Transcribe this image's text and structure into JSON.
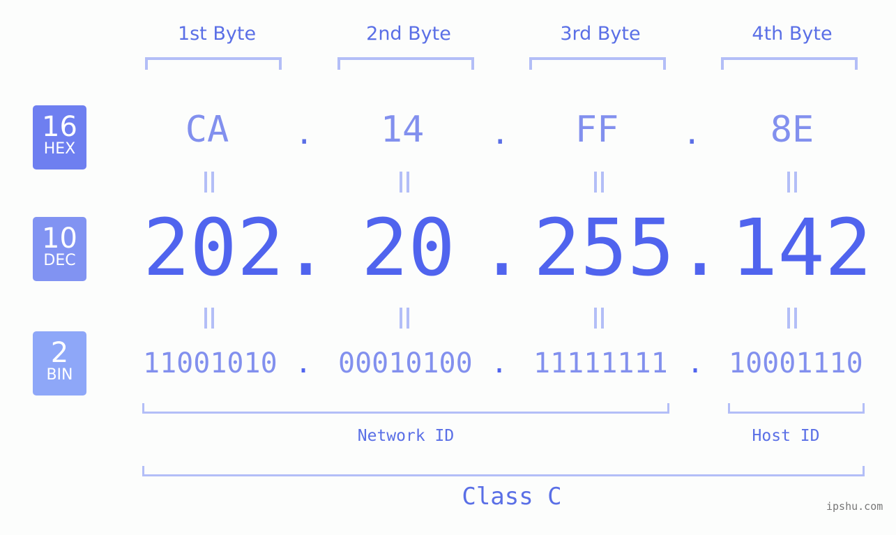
{
  "headers": [
    "1st Byte",
    "2nd Byte",
    "3rd Byte",
    "4th Byte"
  ],
  "badges": [
    {
      "num": "16",
      "label": "HEX",
      "color": "#6e7ff0"
    },
    {
      "num": "10",
      "label": "DEC",
      "color": "#8193f2"
    },
    {
      "num": "2",
      "label": "BIN",
      "color": "#8ea7f8"
    }
  ],
  "hex": [
    "CA",
    "14",
    "FF",
    "8E"
  ],
  "dec": [
    "202",
    "20",
    "255",
    "142"
  ],
  "bin": [
    "11001010",
    "00010100",
    "11111111",
    "10001110"
  ],
  "separator": ".",
  "network_id_label": "Network ID",
  "host_id_label": "Host ID",
  "class_label": "Class C",
  "watermark": "ipshu.com"
}
